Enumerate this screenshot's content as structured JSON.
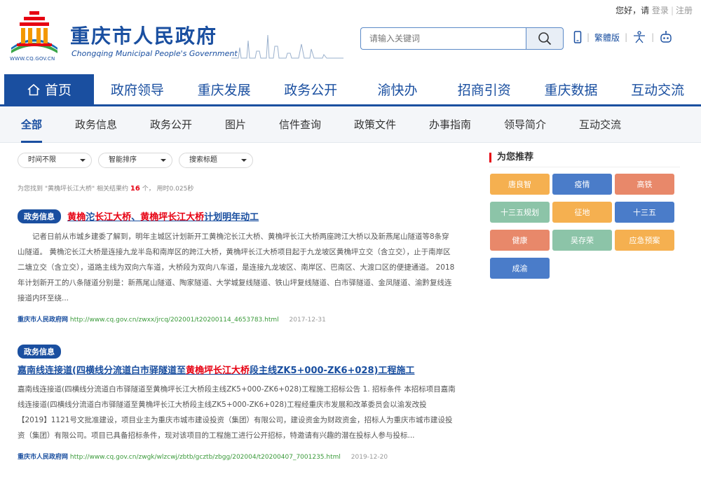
{
  "header": {
    "site_title": "重庆市人民政府",
    "site_subtitle": "Chongqing Municipal People's Government",
    "logo_url": "WWW.CQ.GOV.CN",
    "greeting": "您好，请",
    "login": "登录",
    "register": "注册",
    "search_placeholder": "请输入关键词",
    "traditional": "繁體版"
  },
  "mainnav": [
    "首页",
    "政府领导",
    "重庆发展",
    "政务公开",
    "渝快办",
    "招商引资",
    "重庆数据",
    "互动交流"
  ],
  "subnav": [
    "全部",
    "政务信息",
    "政务公开",
    "图片",
    "信件查询",
    "政策文件",
    "办事指南",
    "领导简介",
    "互动交流"
  ],
  "filters": [
    "时间不限",
    "智能排序",
    "搜索标题"
  ],
  "result_info": {
    "prefix": "为您找到 \"黄桷坪长江大桥\" 相关结果约",
    "count": "16",
    "suffix": "个， 用时0.025秒"
  },
  "results": [
    {
      "tag": "政务信息",
      "title_hl1": "黄桷",
      "title_p1": "沱",
      "title_hl2": "长江大桥",
      "title_p2": "、",
      "title_hl3": "黄桷坪长江大桥",
      "title_p3": "计划明年动工",
      "body": "记者日前从市城乡建委了解到，明年主城区计划新开工黄桷沱长江大桥、黄桷坪长江大桥两座跨江大桥以及新燕尾山隧道等8条穿山隧道。     黄桷沱长江大桥是连接九龙半岛和南岸区的跨江大桥，黄桷坪长江大桥项目起于九龙坡区黄桷坪立交（含立交），止于南岸区二塘立交（含立交），道路主线为双向六车道，大桥段为双向八车道，是连接九龙坡区、南岸区、巴南区、大渡口区的便捷通道。     2018年计划新开工的八条隧道分别是：新燕尾山隧道、陶家隧道、大学城复线隧道、铁山坪复线隧道、白市驿隧道、金凤隧道、渝黔复线连接道内环至绕...",
      "source": "重庆市人民政府网",
      "url": "http://www.cq.gov.cn/zwxx/jrcq/202001/t20200114_4653783.html",
      "date": "2017-12-31"
    },
    {
      "tag": "政务信息",
      "title_p1": "嘉南线连接道(四横线分流道白市驿隧道至",
      "title_hl1": "黄桷坪长江大桥",
      "title_p2": "段主线ZK5+000-ZK6+028)工程施工",
      "body": "嘉南线连接道(四横线分流道白市驿隧道至黄桷坪长江大桥段主线ZK5+000-ZK6+028)工程施工招标公告 1. 招标条件     本招标项目嘉南线连接道(四横线分流道白市驿隧道至黄桷坪长江大桥段主线ZK5+000-ZK6+028)工程经重庆市发展和改革委员会以渝发改投【2019】1121号文批准建设，项目业主为重庆市城市建设投资（集团）有限公司，建设资金为财政资金，招标人为重庆市城市建设投资（集团）有限公司。项目已具备招标条件，现对该项目的工程施工进行公开招标，特邀请有兴趣的潜在投标人参与投标...",
      "source": "重庆市人民政府网",
      "url": "http://www.cq.gov.cn/zwgk/wlzcwj/zbtb/gcztb/zbgg/202004/t20200407_7001235.html",
      "date": "2019-12-20"
    }
  ],
  "recommend": {
    "title": "为您推荐",
    "items": [
      {
        "label": "唐良智",
        "color": "#f5b050"
      },
      {
        "label": "疫情",
        "color": "#4a7cc9"
      },
      {
        "label": "高铁",
        "color": "#e8886a"
      },
      {
        "label": "十三五规划",
        "color": "#8cc4a8"
      },
      {
        "label": "征地",
        "color": "#f5b050"
      },
      {
        "label": "十三五",
        "color": "#4a7cc9"
      },
      {
        "label": "健康",
        "color": "#e8886a"
      },
      {
        "label": "吴存荣",
        "color": "#8cc4a8"
      },
      {
        "label": "应急预案",
        "color": "#f5b050"
      },
      {
        "label": "成渝",
        "color": "#4a7cc9"
      }
    ]
  }
}
